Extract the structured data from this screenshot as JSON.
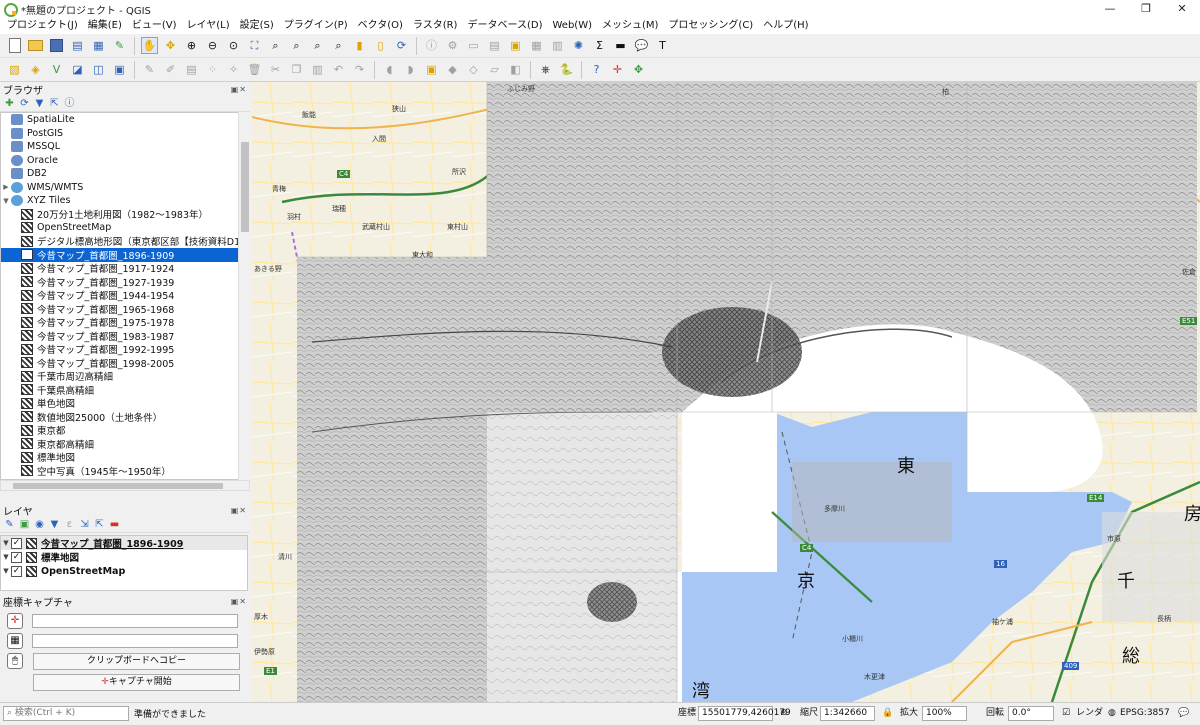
{
  "window": {
    "title": "*無題のプロジェクト - QGIS",
    "controls": [
      "—",
      "❐",
      "✕"
    ]
  },
  "menubar": {
    "items": [
      "プロジェクト(J)",
      "編集(E)",
      "ビュー(V)",
      "レイヤ(L)",
      "設定(S)",
      "プラグイン(P)",
      "ベクタ(O)",
      "ラスタ(R)",
      "データベース(D)",
      "Web(W)",
      "メッシュ(M)",
      "プロセッシング(C)",
      "ヘルプ(H)"
    ]
  },
  "browser": {
    "title": "ブラウザ",
    "items": [
      {
        "label": "SpatiaLite",
        "icon": "spatialite-icon"
      },
      {
        "label": "PostGIS",
        "icon": "postgis-icon"
      },
      {
        "label": "MSSQL",
        "icon": "mssql-icon"
      },
      {
        "label": "Oracle",
        "icon": "oracle-icon"
      },
      {
        "label": "DB2",
        "icon": "db2-icon"
      },
      {
        "label": "WMS/WMTS",
        "icon": "wms-icon"
      },
      {
        "label": "XYZ Tiles",
        "icon": "xyz-tiles-icon"
      },
      {
        "label": "20万分1土地利用図（1982～1983年）",
        "icon": "xyz-layer-icon"
      },
      {
        "label": "OpenStreetMap",
        "icon": "xyz-layer-icon"
      },
      {
        "label": "デジタル標高地形図（東京都区部【技術資料D1",
        "icon": "xyz-layer-icon"
      },
      {
        "label": "今昔マップ_首都圏_1896-1909",
        "icon": "xyz-layer-icon"
      },
      {
        "label": "今昔マップ_首都圏_1917-1924",
        "icon": "xyz-layer-icon"
      },
      {
        "label": "今昔マップ_首都圏_1927-1939",
        "icon": "xyz-layer-icon"
      },
      {
        "label": "今昔マップ_首都圏_1944-1954",
        "icon": "xyz-layer-icon"
      },
      {
        "label": "今昔マップ_首都圏_1965-1968",
        "icon": "xyz-layer-icon"
      },
      {
        "label": "今昔マップ_首都圏_1975-1978",
        "icon": "xyz-layer-icon"
      },
      {
        "label": "今昔マップ_首都圏_1983-1987",
        "icon": "xyz-layer-icon"
      },
      {
        "label": "今昔マップ_首都圏_1992-1995",
        "icon": "xyz-layer-icon"
      },
      {
        "label": "今昔マップ_首都圏_1998-2005",
        "icon": "xyz-layer-icon"
      },
      {
        "label": "千葉市周辺高精細",
        "icon": "xyz-layer-icon"
      },
      {
        "label": "千葉県高精細",
        "icon": "xyz-layer-icon"
      },
      {
        "label": "単色地図",
        "icon": "xyz-layer-icon"
      },
      {
        "label": "数値地図25000（土地条件）",
        "icon": "xyz-layer-icon"
      },
      {
        "label": "東京都",
        "icon": "xyz-layer-icon"
      },
      {
        "label": "東京都高精細",
        "icon": "xyz-layer-icon"
      },
      {
        "label": "標準地図",
        "icon": "xyz-layer-icon"
      },
      {
        "label": "空中写真（1945年～1950年）",
        "icon": "xyz-layer-icon"
      }
    ],
    "selected_index": 10
  },
  "layers": {
    "title": "レイヤ",
    "items": [
      {
        "label": "今昔マップ_首都圏_1896-1909",
        "checked": "✓"
      },
      {
        "label": "標準地図",
        "checked": "✓"
      },
      {
        "label": "OpenStreetMap",
        "checked": "✓"
      }
    ]
  },
  "capture": {
    "title": "座標キャプチャ",
    "copy_button": "クリップボードへコピー",
    "start_button": "キャプチャ開始"
  },
  "statusbar": {
    "search_placeholder": "検索(Ctrl + K)",
    "message": "準備ができました",
    "coordinate_label": "座標",
    "coordinate_value": "15501779,4260179",
    "scale_label": "縮尺",
    "scale_value": "1:342660",
    "magnifier_label": "拡大",
    "magnifier_value": "100%",
    "rotation_label": "回転",
    "rotation_value": "0.0°",
    "render_label": "レンダ",
    "crs": "EPSG:3857"
  },
  "map": {
    "labels": [
      "ふじみ野",
      "所沢",
      "入間",
      "飯能",
      "狭山",
      "瑞穂",
      "武蔵村山",
      "東大和",
      "あきる野",
      "青梅",
      "羽村",
      "東村山",
      "多摩川",
      "市原",
      "袖ケ浦",
      "小櫃川",
      "長柄",
      "木更津",
      "佐倉",
      "柏",
      "清川",
      "厚木",
      "伊勢原"
    ],
    "big_labels": [
      "東",
      "京",
      "湾",
      "千",
      "総",
      "房"
    ],
    "route_shields": [
      "C4",
      "C4",
      "E1",
      "E14",
      "E51",
      "16",
      "409"
    ]
  }
}
